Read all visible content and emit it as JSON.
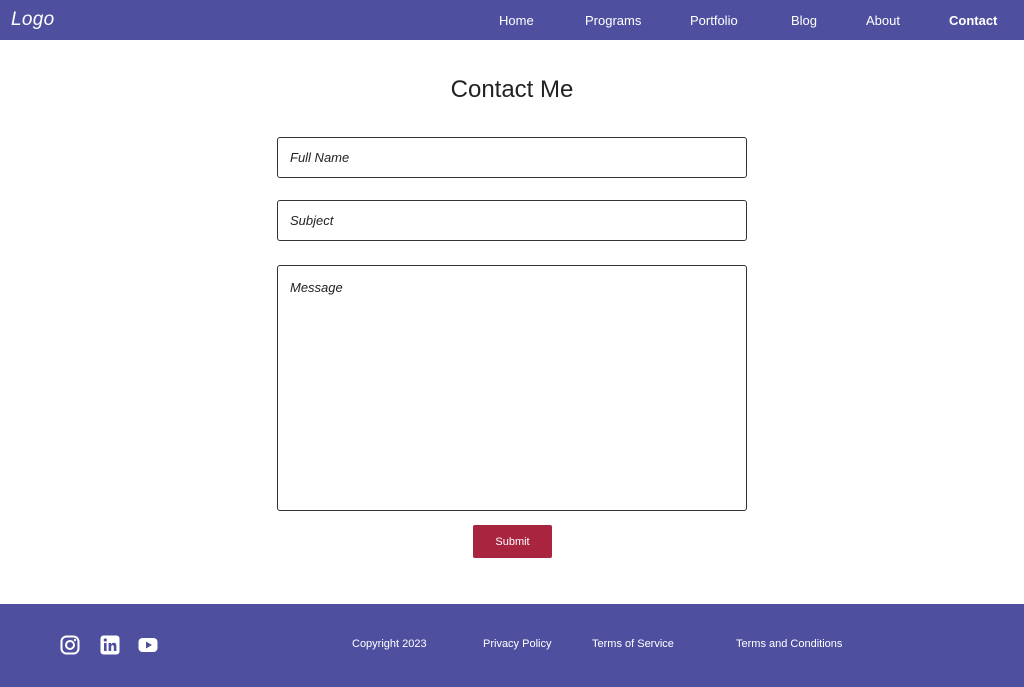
{
  "header": {
    "logo": "Logo",
    "nav": [
      {
        "label": "Home"
      },
      {
        "label": "Programs"
      },
      {
        "label": "Portfolio"
      },
      {
        "label": "Blog"
      },
      {
        "label": "About"
      },
      {
        "label": "Contact",
        "active": true
      }
    ]
  },
  "main": {
    "title": "Contact Me",
    "form": {
      "full_name_placeholder": "Full Name",
      "subject_placeholder": "Subject",
      "message_placeholder": "Message",
      "submit_label": "Submit"
    }
  },
  "footer": {
    "social_icons": [
      "instagram-icon",
      "linkedin-icon",
      "youtube-icon"
    ],
    "copyright": "Copyright 2023",
    "links": [
      "Privacy Policy",
      "Terms of Service",
      "Terms and Conditions"
    ]
  },
  "colors": {
    "header_bg": "#4f4fa0",
    "footer_bg": "#4f4fa0",
    "submit_bg": "#a8243f"
  }
}
